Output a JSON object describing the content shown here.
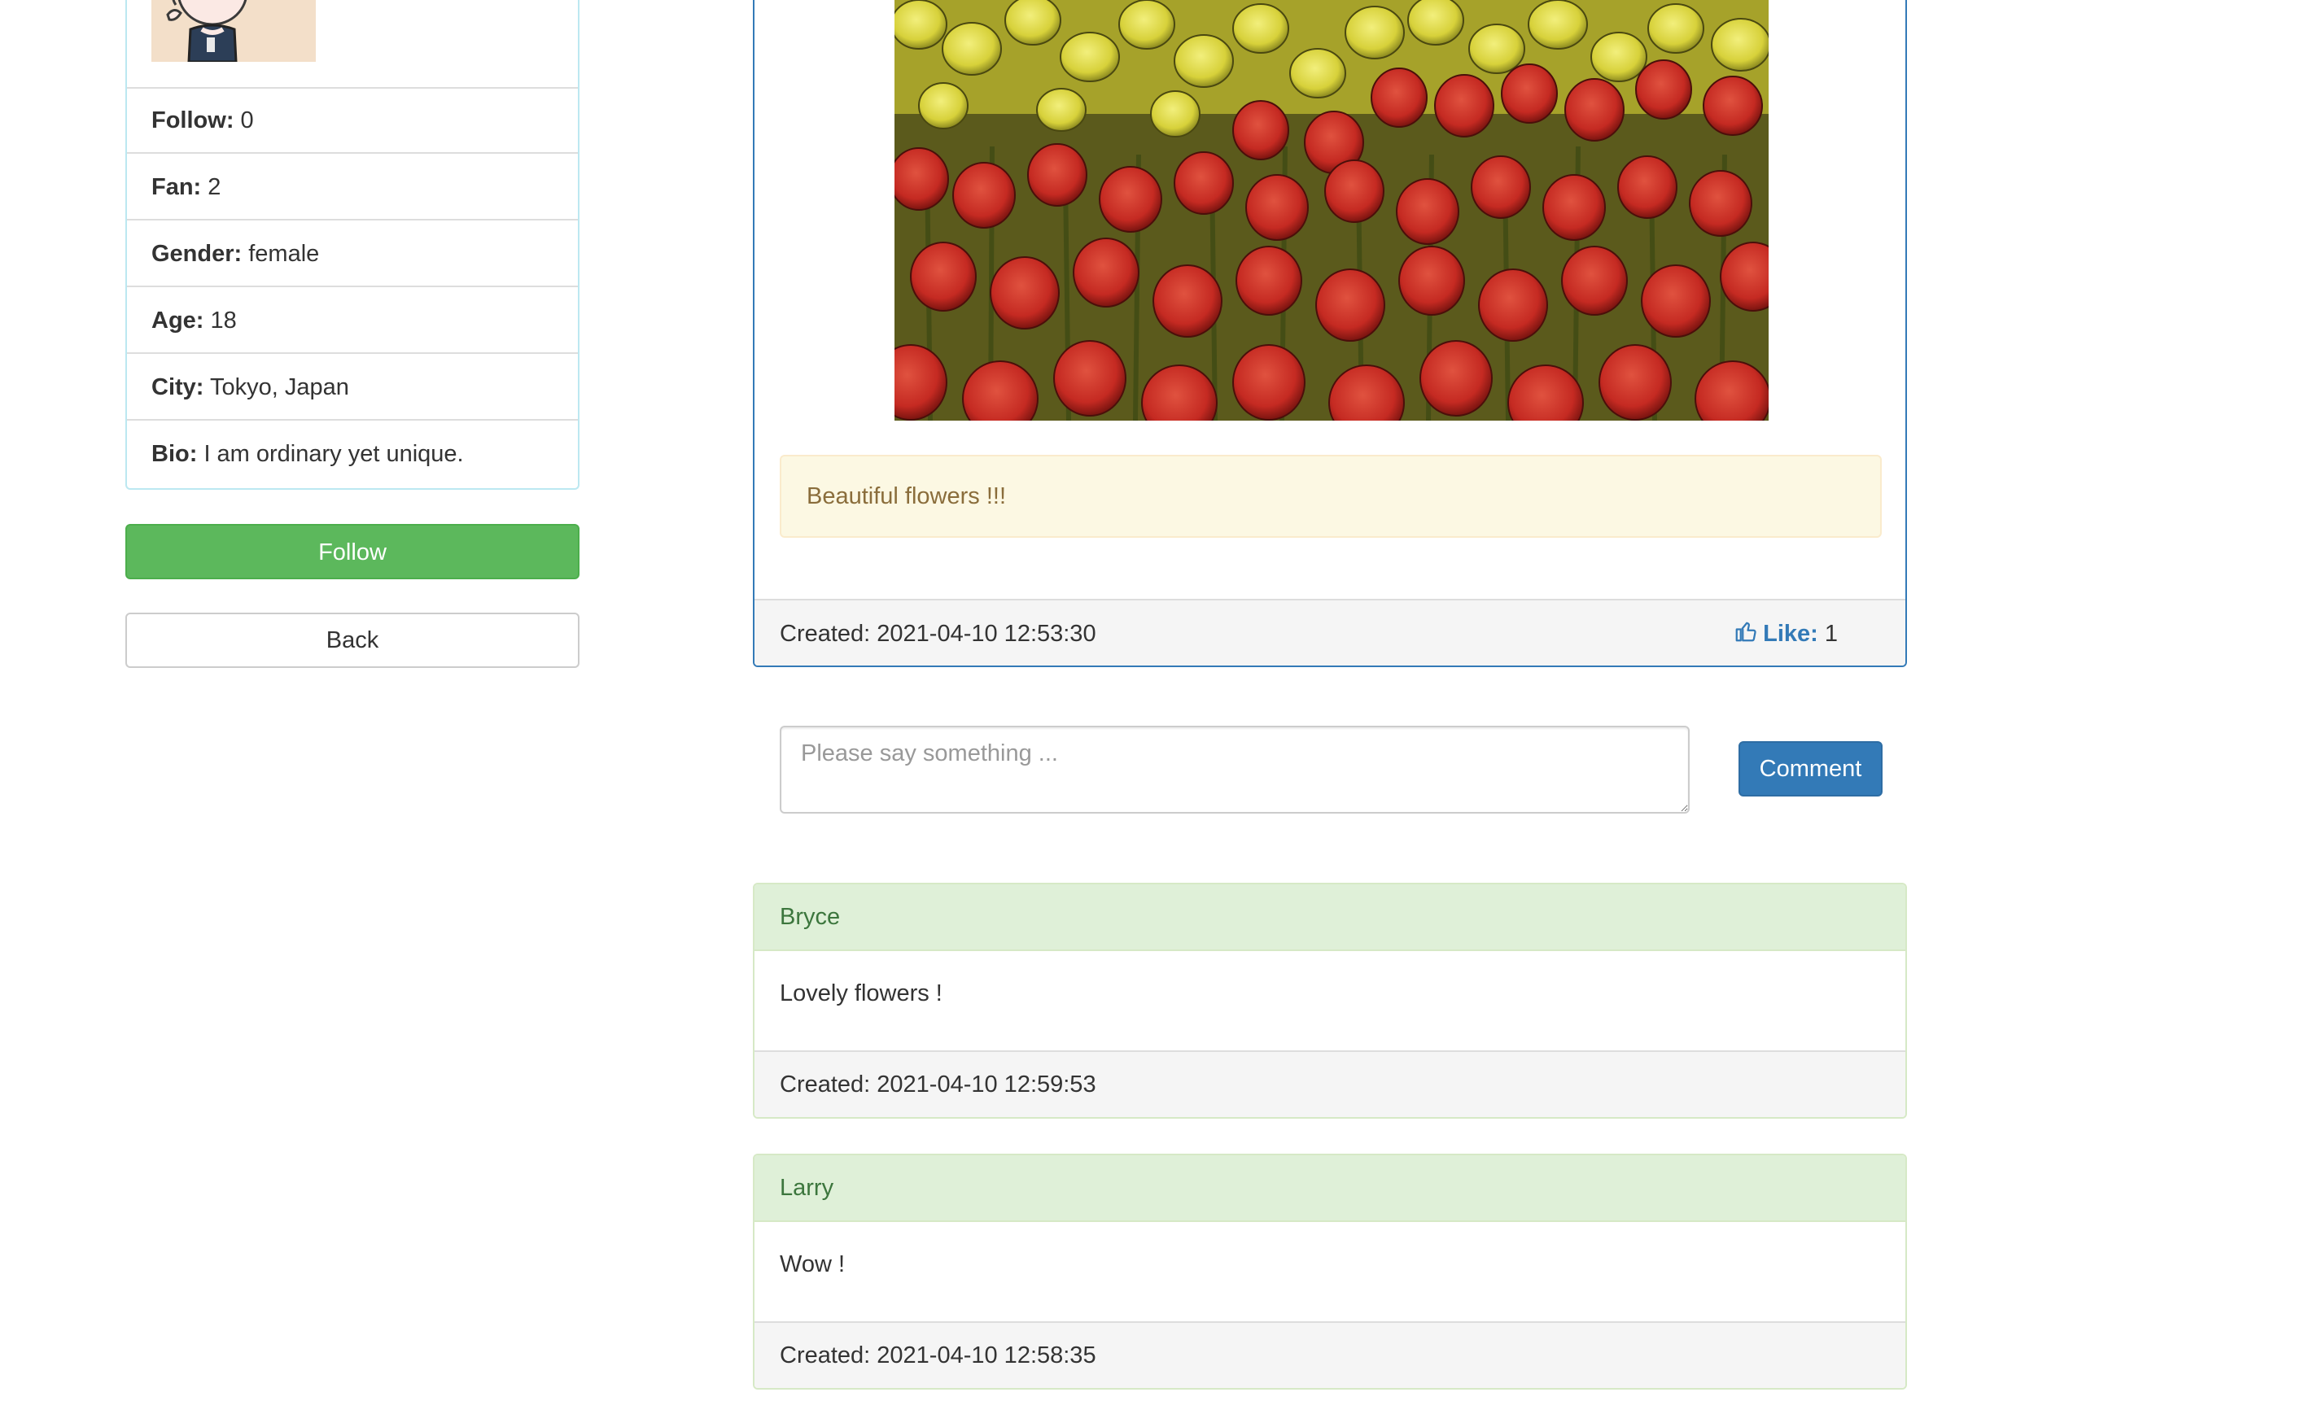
{
  "profile": {
    "avatar_alt": "User avatar",
    "rows": [
      {
        "label": "Follow:",
        "value": "0"
      },
      {
        "label": "Fan:",
        "value": "2"
      },
      {
        "label": "Gender:",
        "value": "female"
      },
      {
        "label": "Age:",
        "value": "18"
      },
      {
        "label": "City:",
        "value": "Tokyo, Japan"
      },
      {
        "label": "Bio:",
        "value": "I am ordinary yet unique."
      }
    ],
    "follow_label": "Follow",
    "back_label": "Back"
  },
  "post": {
    "image_alt": "Field of red and yellow tulips",
    "caption": "Beautiful flowers !!!",
    "created": "Created: 2021-04-10 12:53:30",
    "like_label": "Like:",
    "like_count": "1",
    "like_icon": "thumbs-up-icon"
  },
  "comment_form": {
    "placeholder": "Please say something ...",
    "submit_label": "Comment"
  },
  "comments": [
    {
      "author": "Bryce",
      "text": "Lovely flowers !",
      "created": "Created: 2021-04-10 12:59:53"
    },
    {
      "author": "Larry",
      "text": "Wow !",
      "created": "Created: 2021-04-10 12:58:35"
    }
  ],
  "colors": {
    "primary": "#337ab7",
    "success": "#5cb85c",
    "warning_bg": "#fcf8e3",
    "comment_head_bg": "#dff0d8"
  }
}
